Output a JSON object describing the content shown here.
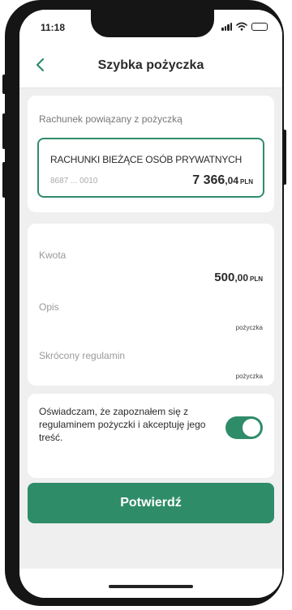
{
  "status_bar": {
    "time": "11:18"
  },
  "header": {
    "title": "Szybka pożyczka"
  },
  "account_section": {
    "label": "Rachunek powiązany z pożyczką",
    "account_name": "RACHUNKI BIEŻĄCE OSÓB PRYWATNYCH",
    "account_number": "8687 ... 0010",
    "balance_integer": "7 366",
    "balance_decimal": ",04",
    "currency": "PLN"
  },
  "details": {
    "amount_label": "Kwota",
    "amount_integer": "500",
    "amount_decimal": ",00",
    "amount_currency": "PLN",
    "description_label": "Opis",
    "description_value": "pożyczka",
    "terms_label": "Skrócony regulamin",
    "terms_value": "pożyczka"
  },
  "consent": {
    "text": "Oświadczam, że zapoznałem się z regulaminem pożyczki i akceptuję jego treść.",
    "toggle_on": true
  },
  "actions": {
    "confirm_label": "Potwierdź"
  },
  "colors": {
    "accent": "#2f8c69",
    "background": "#efefef",
    "card": "#ffffff"
  }
}
